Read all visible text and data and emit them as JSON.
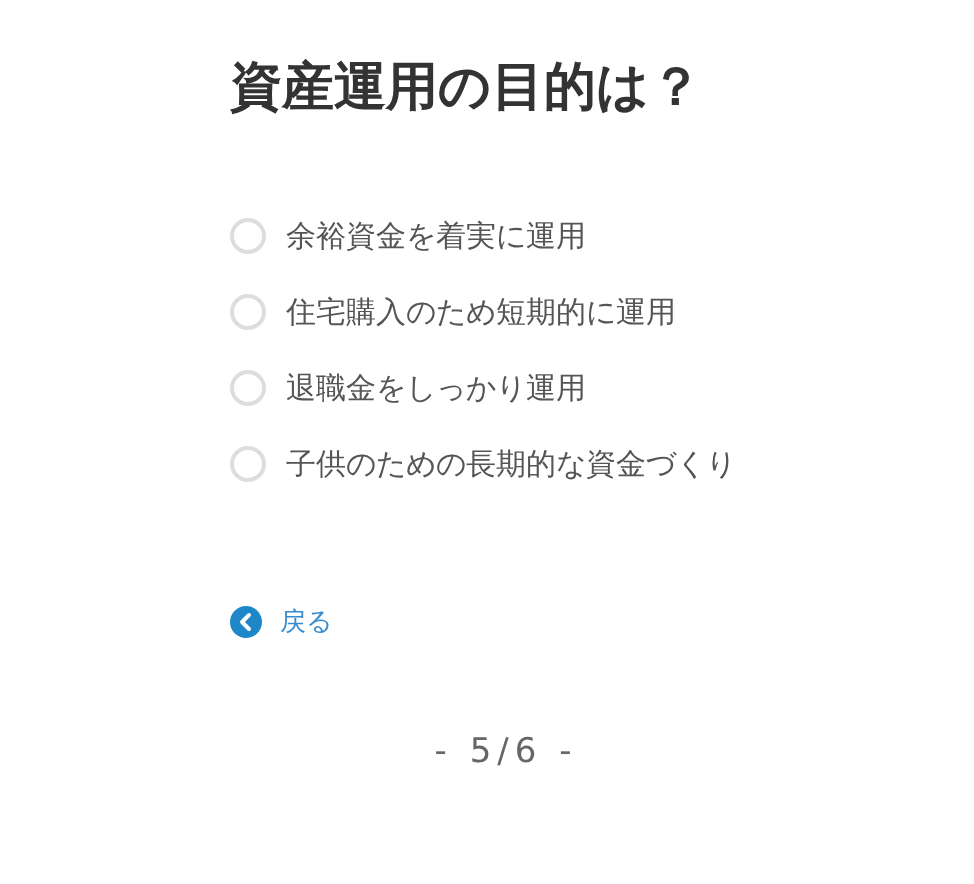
{
  "question": "資産運用の目的は？",
  "options": [
    {
      "label": "余裕資金を着実に運用",
      "selected": false
    },
    {
      "label": "住宅購入のため短期的に運用",
      "selected": false
    },
    {
      "label": "退職金をしっかり運用",
      "selected": false
    },
    {
      "label": "子供のための長期的な資金づくり",
      "selected": false
    }
  ],
  "back_link": "戻る",
  "progress": "- 5/6 -"
}
